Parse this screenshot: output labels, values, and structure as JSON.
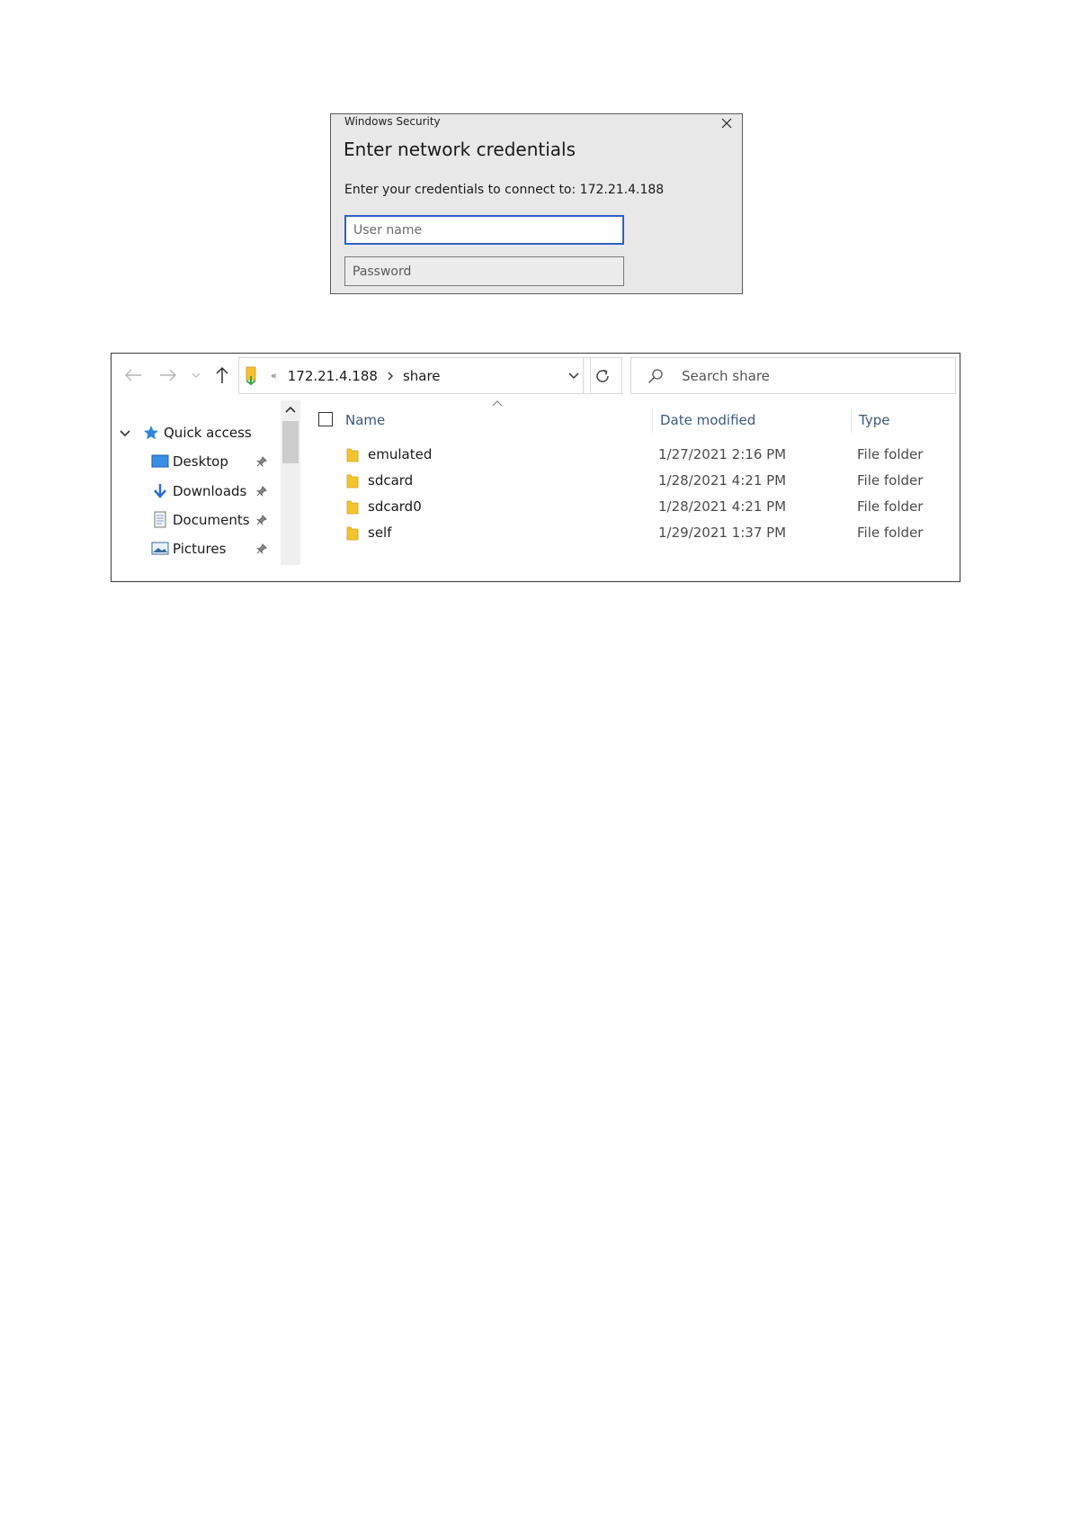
{
  "security_dialog": {
    "app_title": "Windows Security",
    "heading": "Enter network credentials",
    "description": "Enter your credentials to connect to: 172.21.4.188",
    "username_placeholder": "User name",
    "password_placeholder": "Password",
    "close_icon": "close-icon"
  },
  "explorer": {
    "breadcrumb": [
      "172.21.4.188",
      "share"
    ],
    "search_placeholder": "Search share",
    "nav_pane": {
      "quick_access": "Quick access",
      "items": [
        {
          "label": "Desktop",
          "icon": "desktop-icon",
          "pinned": true
        },
        {
          "label": "Downloads",
          "icon": "downloads-icon",
          "pinned": true
        },
        {
          "label": "Documents",
          "icon": "documents-icon",
          "pinned": true
        },
        {
          "label": "Pictures",
          "icon": "pictures-icon",
          "pinned": true
        }
      ]
    },
    "columns": {
      "name": "Name",
      "date": "Date modified",
      "type": "Type"
    },
    "files": [
      {
        "name": "emulated",
        "date": "1/27/2021 2:16 PM",
        "type": "File folder"
      },
      {
        "name": "sdcard",
        "date": "1/28/2021 4:21 PM",
        "type": "File folder"
      },
      {
        "name": "sdcard0",
        "date": "1/28/2021 4:21 PM",
        "type": "File folder"
      },
      {
        "name": "self",
        "date": "1/29/2021 1:37 PM",
        "type": "File folder"
      }
    ]
  },
  "colors": {
    "input_focus_border": "#2f62c4",
    "folder_yellow": "#f4c430",
    "quick_access_star": "#2b88d8",
    "header_text": "#3c5a7a"
  }
}
